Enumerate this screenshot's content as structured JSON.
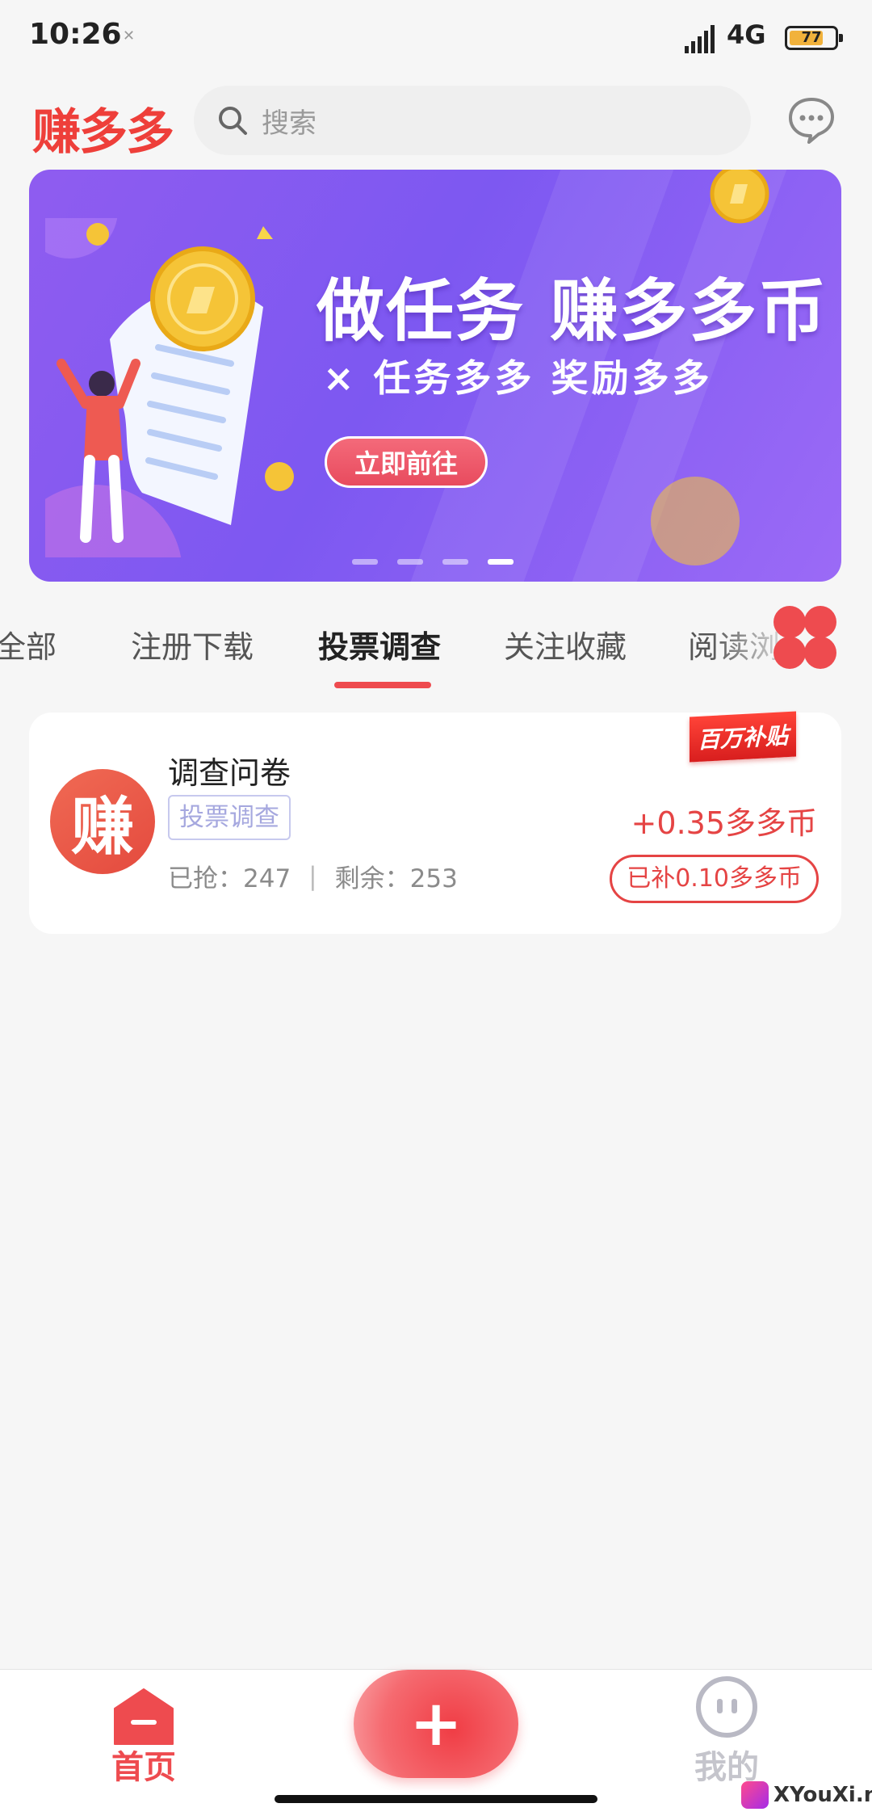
{
  "status_bar": {
    "time": "10:26",
    "network": "4G",
    "battery": "77"
  },
  "header": {
    "logo": "赚多多",
    "search_placeholder": "搜索"
  },
  "banner": {
    "title": "做任务 赚多多币",
    "subtitle": "× 任务多多 奖励多多",
    "button": "立即前往",
    "pages": 4,
    "active_page": 4
  },
  "tabs": [
    {
      "label": "全部"
    },
    {
      "label": "注册下载"
    },
    {
      "label": "投票调查",
      "active": true
    },
    {
      "label": "关注收藏"
    },
    {
      "label": "阅读浏"
    }
  ],
  "task": {
    "avatar_text": "赚",
    "name": "调查问卷",
    "category": "投票调查",
    "grabbed": "已抢：247",
    "remaining": "剩余：253",
    "ribbon": "百万补贴",
    "reward": "+0.35多多币",
    "subsidy": "已补0.10多多币"
  },
  "nav": {
    "home": "首页",
    "plus": "+",
    "me": "我的"
  },
  "watermark": "XYouXi.net",
  "colors": {
    "accent": "#ee4b4f",
    "banner": "#8a5cf2",
    "tag": "#a6a8df"
  }
}
